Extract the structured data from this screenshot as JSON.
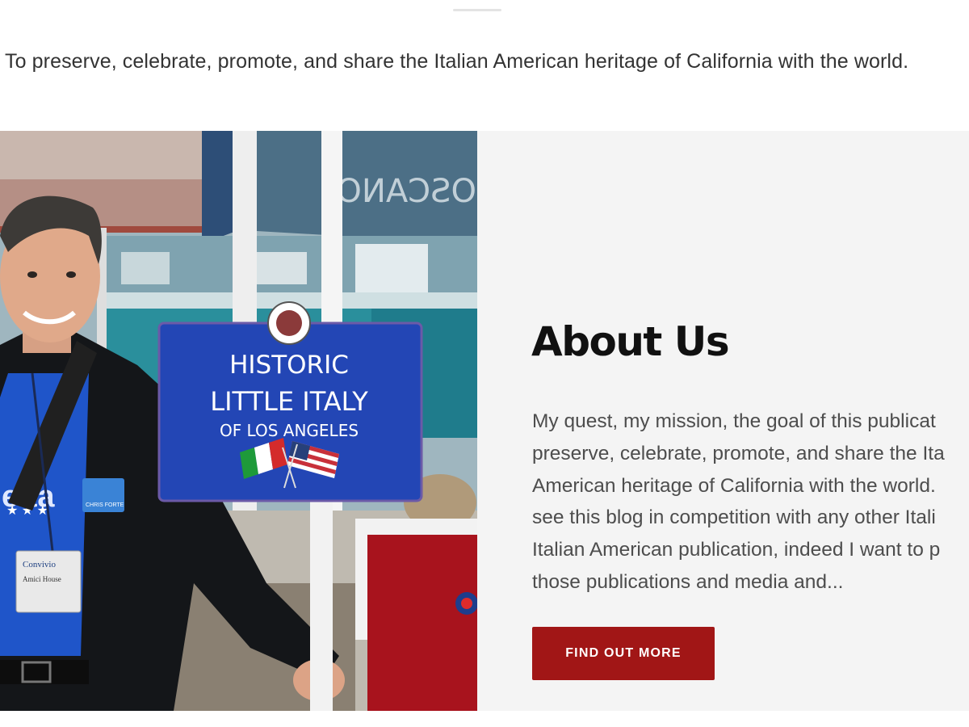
{
  "mission": {
    "text": "To preserve, celebrate, promote, and share the Italian American heritage of California with the world."
  },
  "photo": {
    "sign": {
      "line1": "HISTORIC",
      "line2": "LITTLE ITALY",
      "line3": "OF LOS ANGELES"
    },
    "awning_text": "OSCANO",
    "badge_text": "CHRIS FORTE",
    "tag_line1": "Convivio",
    "tag_line2": "Amici House",
    "shirt_text": "eita"
  },
  "about": {
    "heading": "About Us",
    "lines": [
      "My quest, my mission, the goal of this publicat",
      "preserve, celebrate, promote, and share the Ita",
      "American heritage of California with the world.",
      "see this blog in competition with any other Itali",
      "Italian American publication, indeed I want to p",
      "those publications and media and..."
    ],
    "button_label": "FIND OUT MORE"
  },
  "colors": {
    "button": "#a11616",
    "panel_bg": "#f4f4f4",
    "sign_blue": "#2346b5"
  }
}
